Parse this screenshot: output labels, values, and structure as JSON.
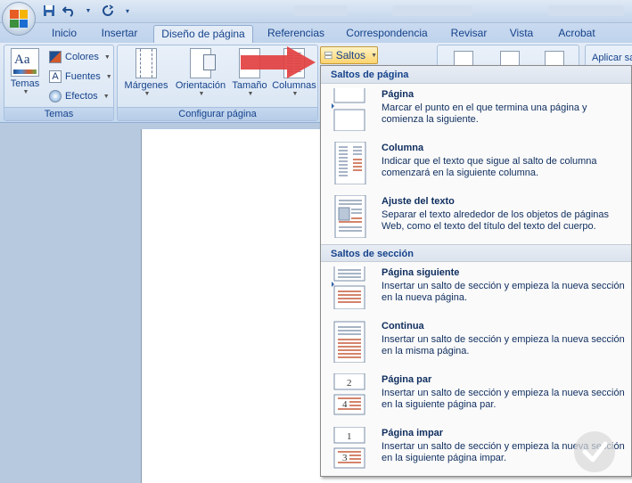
{
  "quick_access": {
    "save": "save-icon",
    "undo": "undo-icon",
    "redo": "redo-icon"
  },
  "tabs": [
    "Inicio",
    "Insertar",
    "Diseño de página",
    "Referencias",
    "Correspondencia",
    "Revisar",
    "Vista",
    "Acrobat"
  ],
  "active_tab": "Diseño de página",
  "ribbon": {
    "temas_group": {
      "temas_label": "Temas",
      "colores": "Colores",
      "fuentes": "Fuentes",
      "efectos": "Efectos",
      "group_label": "Temas"
    },
    "configurar_group": {
      "margenes": "Márgenes",
      "orientacion": "Orientación",
      "tamano": "Tamaño",
      "columnas": "Columnas",
      "group_label": "Configurar página"
    },
    "right_partial": "Aplicar sa"
  },
  "saltos_button": "Saltos",
  "menu": {
    "section1_header": "Saltos de página",
    "section1_items": [
      {
        "title": "Página",
        "desc": "Marcar el punto en el que termina una página y comienza la siguiente."
      },
      {
        "title": "Columna",
        "desc": "Indicar que el texto que sigue al salto de columna comenzará en la siguiente columna."
      },
      {
        "title": "Ajuste del texto",
        "desc": "Separar el texto alrededor de los objetos de páginas Web, como el texto del título del texto del cuerpo."
      }
    ],
    "section2_header": "Saltos de sección",
    "section2_items": [
      {
        "title": "Página siguiente",
        "desc": "Insertar un salto de sección y empieza la nueva sección en la nueva página."
      },
      {
        "title": "Continua",
        "desc": "Insertar un salto de sección y empieza la nueva sección en la misma página."
      },
      {
        "title": "Página par",
        "desc": "Insertar un salto de sección y empieza la nueva sección en la siguiente página par."
      },
      {
        "title": "Página impar",
        "desc": "Insertar un salto de sección y empieza la nueva sección en la siguiente página impar."
      }
    ]
  },
  "colors": {
    "accent_arrow": "#e24040",
    "ribbon_blue": "#15428b",
    "hover_gold": "#ffd46e"
  }
}
